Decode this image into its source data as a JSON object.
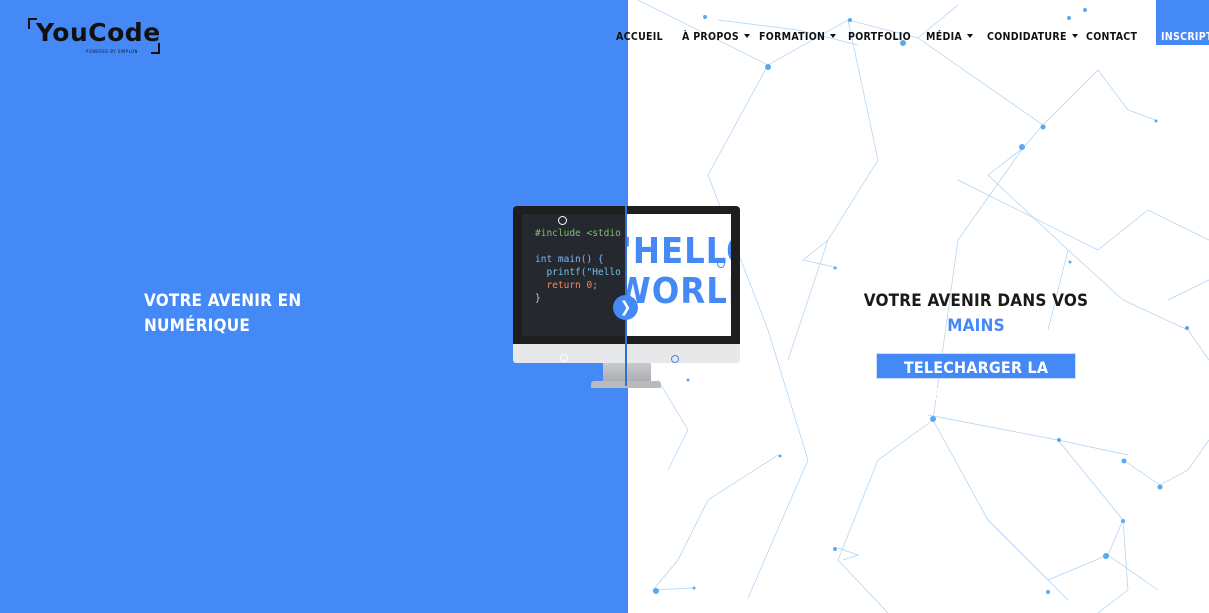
{
  "brand": {
    "logo_text": "YouCode",
    "logo_tagline": "POWERED BY SIMPLON",
    "accent_color": "#4589f6"
  },
  "nav": {
    "items": [
      {
        "label": "ACCUEIL",
        "dropdown": false
      },
      {
        "label": "À PROPOS",
        "dropdown": true
      },
      {
        "label": "FORMATION",
        "dropdown": true
      },
      {
        "label": "PORTFOLIO",
        "dropdown": false
      },
      {
        "label": "MÉDIA",
        "dropdown": true
      },
      {
        "label": "CONDIDATURE",
        "dropdown": true
      },
      {
        "label": "CONTACT",
        "dropdown": false
      }
    ],
    "cta_label": "INSCRIPTION"
  },
  "hero": {
    "left_line1": "VOTRE AVENIR EN",
    "left_line2": "NUMÉRIQUE",
    "right_line1": "VOTRE AVENIR DANS VOS",
    "right_line2": "MAINS",
    "brochure_label": "TELECHARGER LA BROCHURE"
  },
  "monitor": {
    "code_lines": [
      "#include <stdio",
      "",
      "int main() {",
      "  printf(\"Hello",
      "  return 0;",
      "}"
    ],
    "hello_lines": [
      "\"HELLO",
      "WORLD\""
    ],
    "slider_icon": "chevron-right-icon"
  }
}
